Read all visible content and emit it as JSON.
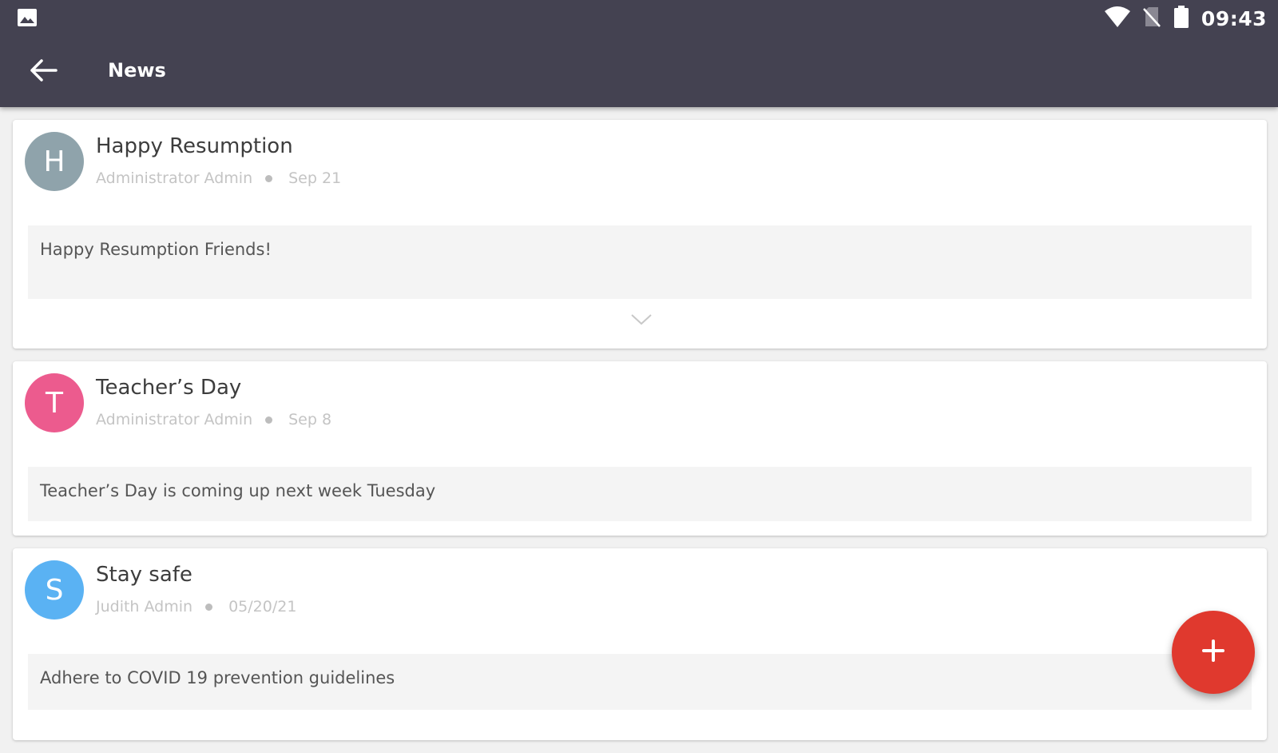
{
  "status_bar": {
    "time": "09:43",
    "icons": [
      "gallery-notification-icon",
      "wifi-icon",
      "no-sim-icon",
      "battery-icon"
    ]
  },
  "toolbar": {
    "title": "News",
    "back_icon": "arrow-left-icon"
  },
  "posts": [
    {
      "avatar_letter": "H",
      "avatar_color": "#8fa3ab",
      "title": "Happy Resumption",
      "author": "Administrator Admin",
      "date": "Sep 21",
      "body": "Happy Resumption Friends!",
      "expand_icon": "chevron-down-icon"
    },
    {
      "avatar_letter": "T",
      "avatar_color": "#ec5b8e",
      "title": "Teacher’s Day",
      "author": "Administrator Admin",
      "date": "Sep 8",
      "body": "Teacher’s Day is coming up next week Tuesday"
    },
    {
      "avatar_letter": "S",
      "avatar_color": "#5ab2f3",
      "title": "Stay safe",
      "author": "Judith Admin",
      "date": "05/20/21",
      "body": "Adhere to COVID 19 prevention guidelines"
    }
  ],
  "fab": {
    "icon": "plus-icon",
    "color": "#e0392e"
  },
  "colors": {
    "appbar": "#444251",
    "background": "#f1f1f1"
  }
}
